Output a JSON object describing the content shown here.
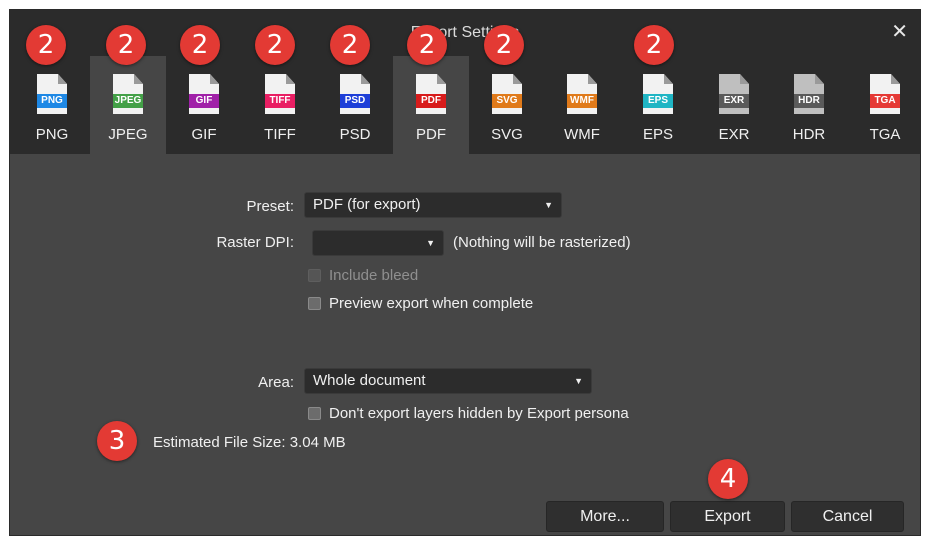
{
  "dialog": {
    "title": "Export Settings",
    "close_glyph": "✕"
  },
  "formats": [
    {
      "label": "PNG",
      "tag": "PNG",
      "color": "#1e88e5",
      "active": false
    },
    {
      "label": "JPEG",
      "tag": "JPEG",
      "color": "#43a047",
      "active": true
    },
    {
      "label": "GIF",
      "tag": "GIF",
      "color": "#a020a8",
      "active": false
    },
    {
      "label": "TIFF",
      "tag": "TIFF",
      "color": "#e91e63",
      "active": false
    },
    {
      "label": "PSD",
      "tag": "PSD",
      "color": "#1e3fd8",
      "active": false
    },
    {
      "label": "PDF",
      "tag": "PDF",
      "color": "#d81b1b",
      "active": true
    },
    {
      "label": "SVG",
      "tag": "SVG",
      "color": "#e07a1a",
      "active": false
    },
    {
      "label": "WMF",
      "tag": "WMF",
      "color": "#e07a1a",
      "active": false
    },
    {
      "label": "EPS",
      "tag": "EPS",
      "color": "#1fb5c4",
      "active": false
    },
    {
      "label": "EXR",
      "tag": "EXR",
      "color": "#5a5a5a",
      "active": false
    },
    {
      "label": "HDR",
      "tag": "HDR",
      "color": "#5a5a5a",
      "active": false
    },
    {
      "label": "TGA",
      "tag": "TGA",
      "color": "#e53935",
      "active": false
    }
  ],
  "annotations": {
    "formats": "2",
    "file_size": "3",
    "export": "4"
  },
  "settings": {
    "preset_label": "Preset:",
    "preset_value": "PDF (for export)",
    "raster_label": "Raster DPI:",
    "raster_value": "",
    "raster_note": "(Nothing will be rasterized)",
    "include_bleed": "Include bleed",
    "preview_export": "Preview export when complete",
    "area_label": "Area:",
    "area_value": "Whole document",
    "hidden_layers": "Don't export layers hidden by Export persona",
    "file_size": "Estimated File Size: 3.04 MB"
  },
  "buttons": {
    "more": "More...",
    "export": "Export",
    "cancel": "Cancel"
  },
  "colors": {
    "badge": "#e33a34",
    "panel": "#464646",
    "header": "#2b2b2b"
  }
}
